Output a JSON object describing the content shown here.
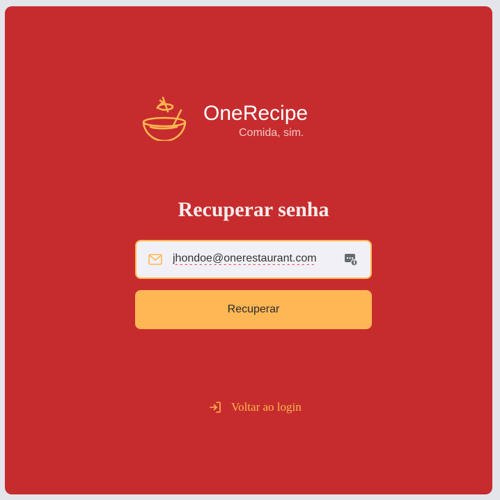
{
  "brand": {
    "name": "OneRecipe",
    "tagline": "Comida, sim.",
    "logo_icon": "bowl-icon"
  },
  "page": {
    "title": "Recuperar senha"
  },
  "form": {
    "email_value": "jhondoe@onerestaurant.com",
    "email_icon": "mail-icon",
    "autofill_icon": "password-manager-icon",
    "submit_label": "Recuperar"
  },
  "footer": {
    "back_label": "Voltar ao login",
    "back_icon": "login-icon"
  },
  "colors": {
    "background": "#c62c2e",
    "accent": "#ffb655",
    "page": "#e4e5ea"
  }
}
